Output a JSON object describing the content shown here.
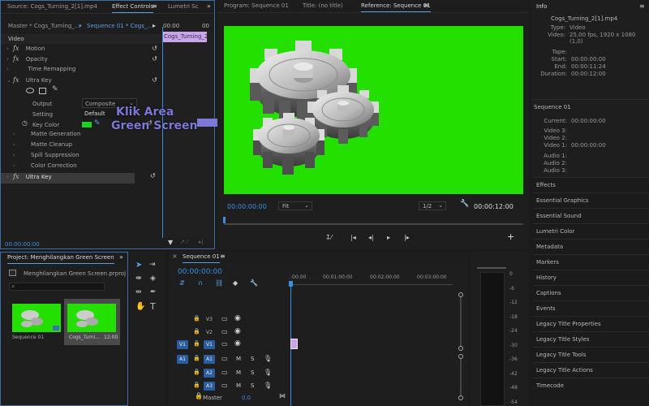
{
  "effect_panel": {
    "tabs": [
      "Source: Cogs_Turning_2[1].mp4",
      "Effect Controls",
      "Lumetri Sc"
    ],
    "master_label": "Master * Cogs_Turning_...",
    "sequence_label": "Sequence 01 * Cogs_...",
    "time_start": "00:00",
    "time_end": "00",
    "clip_label": "Cogs_Turning_2",
    "video_section": "Video",
    "effects": [
      "Motion",
      "Opacity",
      "Time Remapping",
      "Ultra Key"
    ],
    "output_label": "Output",
    "output_value": "Composite",
    "setting_label": "Setting",
    "setting_value": "Default",
    "key_color_label": "Key Color",
    "key_color": "#1fd21f",
    "sub_items": [
      "Matte Generation",
      "Matte Cleanup",
      "Spill Suppression",
      "Color Correction"
    ],
    "ultra_key_bottom": "Ultra Key",
    "timecode": "00:00:00:00"
  },
  "annotation": {
    "line1": "Klik Area",
    "line2": "Green Screen",
    "color": "#7c78d8"
  },
  "monitor": {
    "tabs": [
      "Program: Sequence 01",
      "Title: (no title)",
      "Reference: Sequence 01"
    ],
    "green": "#23e000",
    "timecode_left": "00:00:00:00",
    "fit_label": "Fit",
    "quality": "1/2",
    "timecode_right": "00:00:12:00"
  },
  "info_panel": {
    "title": "Info",
    "file_name": "Cogs_Turning_2[1].mp4",
    "type_label": "Type:",
    "type_value": "Video",
    "video_label": "Video:",
    "video_value": "25,00 fps, 1920 x 1080 (1,0)",
    "tape_label": "Tape:",
    "start_label": "Start:",
    "start_value": "00:00:00:00",
    "end_label": "End:",
    "end_value": "00:00:11:24",
    "duration_label": "Duration:",
    "duration_value": "00:00:12:00",
    "sequence": "Sequence 01",
    "current_label": "Current:",
    "current_value": "00:00:00:00",
    "video3": "Video 3:",
    "video2": "Video 2:",
    "video1": "Video 1:",
    "video1_value": "00:00:00:00",
    "audio1": "Audio 1:",
    "audio2": "Audio 2:",
    "audio3": "Audio 3:"
  },
  "side_panels": [
    "Effects",
    "Essential Graphics",
    "Essential Sound",
    "Lumetri Color",
    "Metadata",
    "Markers",
    "History",
    "Captions",
    "Events",
    "Legacy Title Properties",
    "Legacy Title Styles",
    "Legacy Title Tools",
    "Legacy Title Actions",
    "Timecode"
  ],
  "project": {
    "tab": "Project: Menghilangkan Green Screen",
    "file": "Menghilangkan Green Screen.prproj",
    "items": [
      {
        "name": "Sequence 01",
        "duration": ""
      },
      {
        "name": "Cogs_Turni...",
        "duration": "12:00"
      }
    ]
  },
  "timeline": {
    "tab": "Sequence 01",
    "timecode": "00:00:00:00",
    "ruler": [
      ":00:00",
      "00:01:00:00",
      "00:02:00:00",
      "00:03:00:00"
    ],
    "video_tracks": [
      "V3",
      "V2",
      "V1"
    ],
    "audio_tracks": [
      "A1",
      "A2",
      "A3"
    ],
    "source_v": "V1",
    "source_a": "A1",
    "master_label": "Master",
    "master_value": "0,0"
  },
  "meter_scale": [
    "0",
    "-6",
    "-12",
    "-18",
    "-24",
    "-30",
    "-36",
    "-42",
    "-48",
    "-54"
  ]
}
